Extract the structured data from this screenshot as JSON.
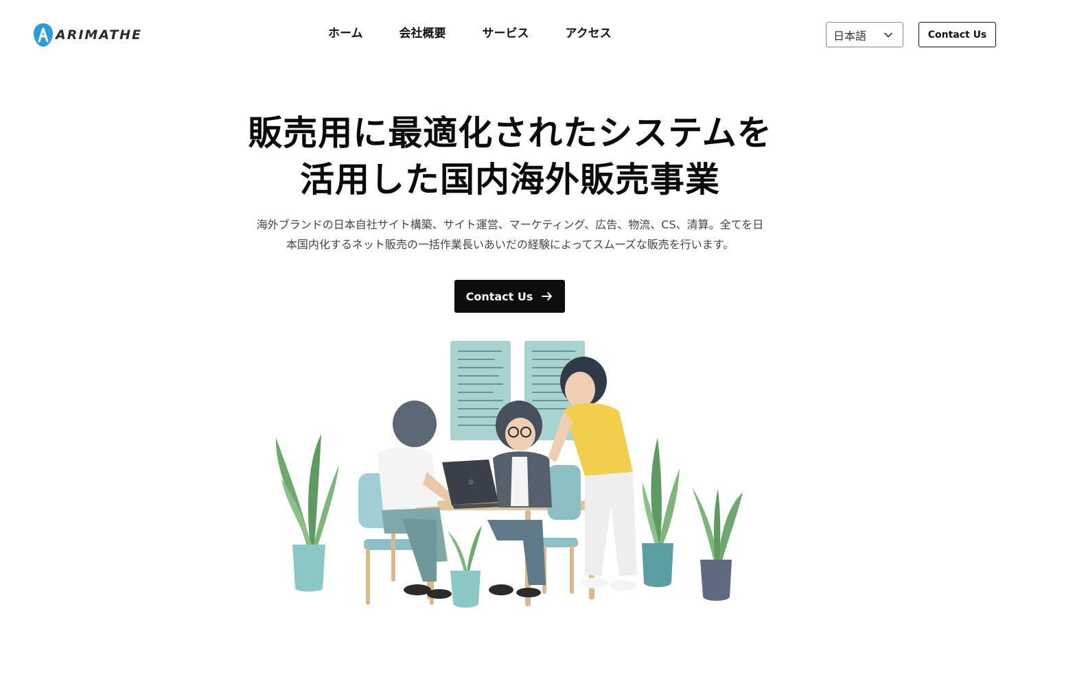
{
  "header": {
    "logo_text": "ARIMATHE",
    "nav": [
      {
        "label": "ホーム"
      },
      {
        "label": "会社概要"
      },
      {
        "label": "サービス"
      },
      {
        "label": "アクセス"
      }
    ],
    "language": {
      "selected": "日本語",
      "icon": "chevron-down-icon"
    },
    "contact_label": "Contact Us"
  },
  "hero": {
    "title_line1": "販売用に最適化されたシステムを",
    "title_line2": "活用した国内海外販売事業",
    "subtitle_line1": "海外ブランドの日本自社サイト構築、サイト運営、マーケティング、広告、物流、CS、清算。全てを日",
    "subtitle_line2": "本国内化するネット販売の一括作業長いあいだの経験によってスムーズな販売を行います。",
    "cta_label": "Contact Us",
    "cta_icon": "arrow-right-icon"
  },
  "colors": {
    "brand_blue": "#2f9ad8",
    "cta_bg": "#0d0d0d",
    "board": "#a9d3cf",
    "plant_green": "#6fa86f",
    "pot_teal": "#6fb3b7",
    "shirt_yellow": "#f2cf4a"
  }
}
